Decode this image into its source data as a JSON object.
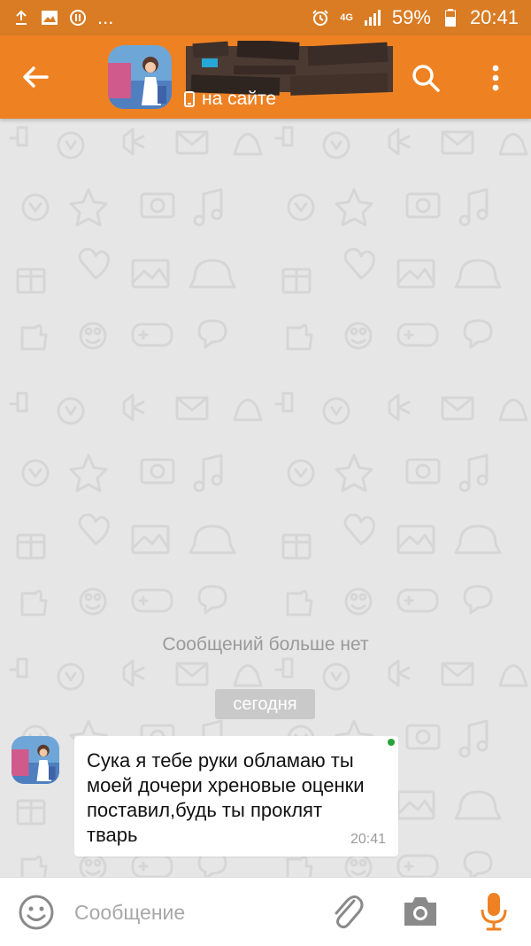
{
  "status_bar": {
    "battery_percent": "59%",
    "time": "20:41",
    "network": "4G",
    "overflow": "..."
  },
  "header": {
    "back_icon": "arrow-left-icon",
    "contact_status": "на сайте",
    "status_icon": "phone-icon",
    "search_icon": "search-icon",
    "menu_icon": "more-vertical-icon"
  },
  "chat": {
    "no_more_messages": "Сообщений больше нет",
    "date_divider": "сегодня",
    "messages": [
      {
        "text": "Сука я тебе руки обламаю ты моей дочери хреновые оценки поставил,будь ты проклят тварь",
        "time": "20:41",
        "online": true
      }
    ]
  },
  "composer": {
    "placeholder": "Сообщение",
    "emoji_icon": "emoji-icon",
    "attach_icon": "paperclip-icon",
    "camera_icon": "camera-icon",
    "mic_icon": "microphone-icon"
  },
  "colors": {
    "accent": "#ee8122",
    "status_bar": "#d97c23",
    "background": "#e6e6e6",
    "mic": "#ee8122",
    "online": "#27a33a"
  }
}
